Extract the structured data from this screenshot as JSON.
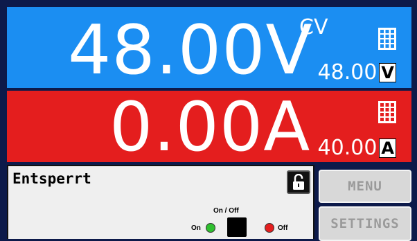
{
  "voltage": {
    "actual": "48.00V",
    "mode": "CV",
    "setpoint": "48.00",
    "unit": "V",
    "keypad_icon": "keypad-icon"
  },
  "current": {
    "actual": "0.00A",
    "setpoint": "40.00",
    "unit": "A",
    "keypad_icon": "keypad-icon"
  },
  "status_panel": {
    "status_text": "Entsperrt",
    "lock_icon": "unlocked-padlock-icon",
    "output_label": "On / Off",
    "on_label": "On",
    "off_label": "Off"
  },
  "buttons": {
    "menu": "MENU",
    "settings": "SETTINGS"
  },
  "colors": {
    "voltage_bg": "#1b8ef2",
    "current_bg": "#e41e1e",
    "on_led": "#2fbf2f",
    "off_led": "#e41e1e"
  }
}
